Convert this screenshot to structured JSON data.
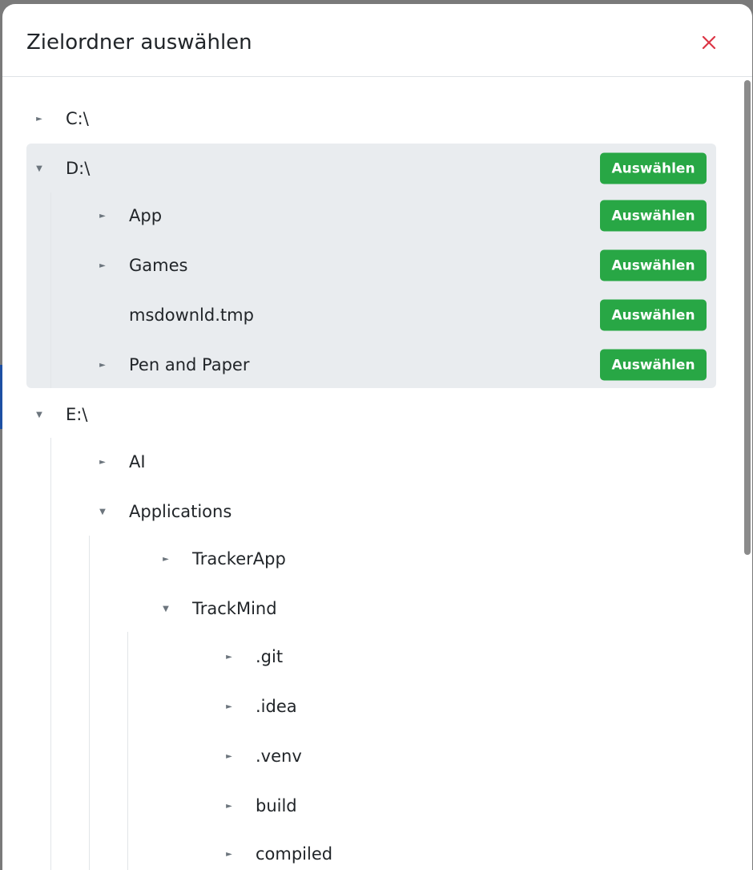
{
  "dialog": {
    "title": "Zielordner auswählen",
    "close_label": "×"
  },
  "select_label": "Auswählen",
  "colors": {
    "accent_green": "#28a745",
    "close_red": "#dc3545",
    "highlight": "#e9ecef"
  },
  "tree": {
    "c_drive": {
      "label": "C:\\",
      "expanded": false
    },
    "d_drive": {
      "label": "D:\\",
      "expanded": true
    },
    "d_app": {
      "label": "App",
      "expanded": false
    },
    "d_games": {
      "label": "Games",
      "expanded": false
    },
    "d_msdownld": {
      "label": "msdownld.tmp"
    },
    "d_penpaper": {
      "label": "Pen and Paper",
      "expanded": false
    },
    "e_drive": {
      "label": "E:\\",
      "expanded": true
    },
    "e_ai": {
      "label": "AI",
      "expanded": false
    },
    "e_applications": {
      "label": "Applications",
      "expanded": true
    },
    "e_trackerapp": {
      "label": "TrackerApp",
      "expanded": false
    },
    "e_trackmind": {
      "label": "TrackMind",
      "expanded": true
    },
    "tm_git": {
      "label": ".git",
      "expanded": false
    },
    "tm_idea": {
      "label": ".idea",
      "expanded": false
    },
    "tm_venv": {
      "label": ".venv",
      "expanded": false
    },
    "tm_build": {
      "label": "build",
      "expanded": false
    },
    "tm_compiled": {
      "label": "compiled",
      "expanded": false
    }
  }
}
